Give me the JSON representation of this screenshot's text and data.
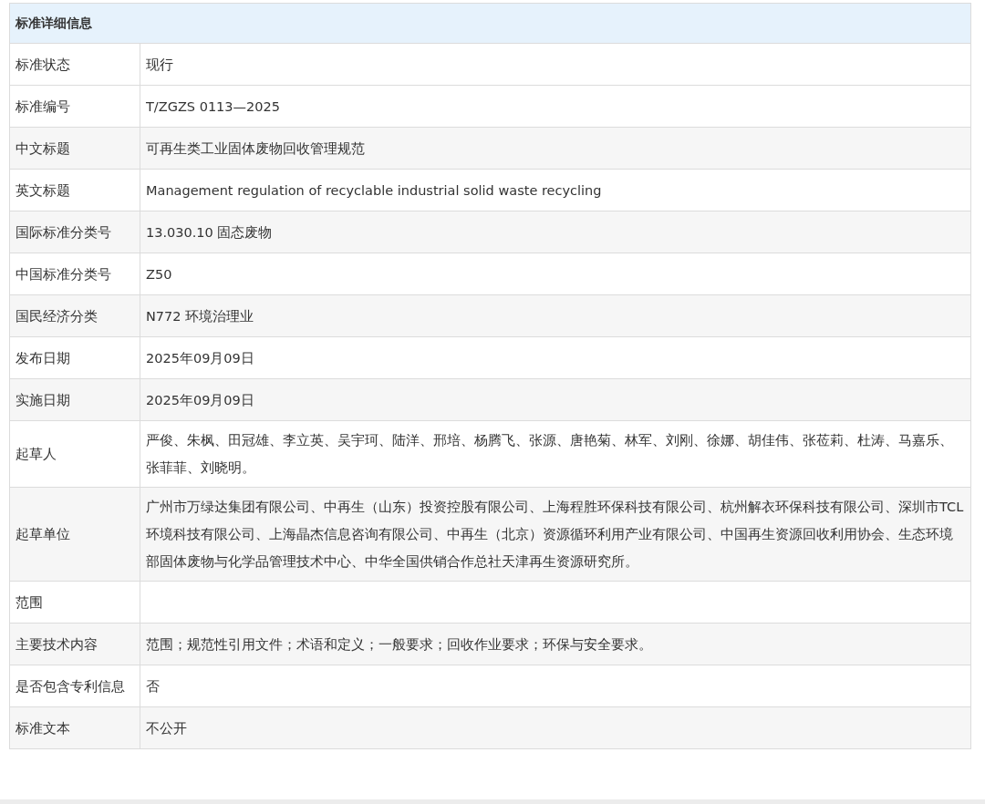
{
  "table": {
    "title": "标准详细信息",
    "rows": [
      {
        "label": "标准状态",
        "value": "现行"
      },
      {
        "label": "标准编号",
        "value": "T/ZGZS 0113—2025"
      },
      {
        "label": "中文标题",
        "value": "可再生类工业固体废物回收管理规范"
      },
      {
        "label": "英文标题",
        "value": "Management regulation of recyclable industrial solid waste recycling"
      },
      {
        "label": "国际标准分类号",
        "value": "13.030.10 固态废物"
      },
      {
        "label": "中国标准分类号",
        "value": "Z50"
      },
      {
        "label": "国民经济分类",
        "value": "N772 环境治理业"
      },
      {
        "label": "发布日期",
        "value": "2025年09月09日"
      },
      {
        "label": "实施日期",
        "value": "2025年09月09日"
      },
      {
        "label": "起草人",
        "value": "严俊、朱枫、田冠雄、李立英、吴宇珂、陆洋、邢培、杨腾飞、张源、唐艳菊、林军、刘刚、徐娜、胡佳伟、张莅莉、杜涛、马嘉乐、张菲菲、刘晓明。"
      },
      {
        "label": "起草单位",
        "value": "广州市万绿达集团有限公司、中再生（山东）投资控股有限公司、上海程胜环保科技有限公司、杭州解衣环保科技有限公司、深圳市TCL环境科技有限公司、上海晶杰信息咨询有限公司、中再生（北京）资源循环利用产业有限公司、中国再生资源回收利用协会、生态环境部固体废物与化学品管理技术中心、中华全国供销合作总社天津再生资源研究所。"
      },
      {
        "label": "范围"
      },
      {
        "label": "主要技术内容",
        "value": "范围；规范性引用文件；术语和定义；一般要求；回收作业要求；环保与安全要求。"
      },
      {
        "label": "是否包含专利信息",
        "value": "否"
      },
      {
        "label": "标准文本",
        "value": "不公开"
      }
    ]
  }
}
